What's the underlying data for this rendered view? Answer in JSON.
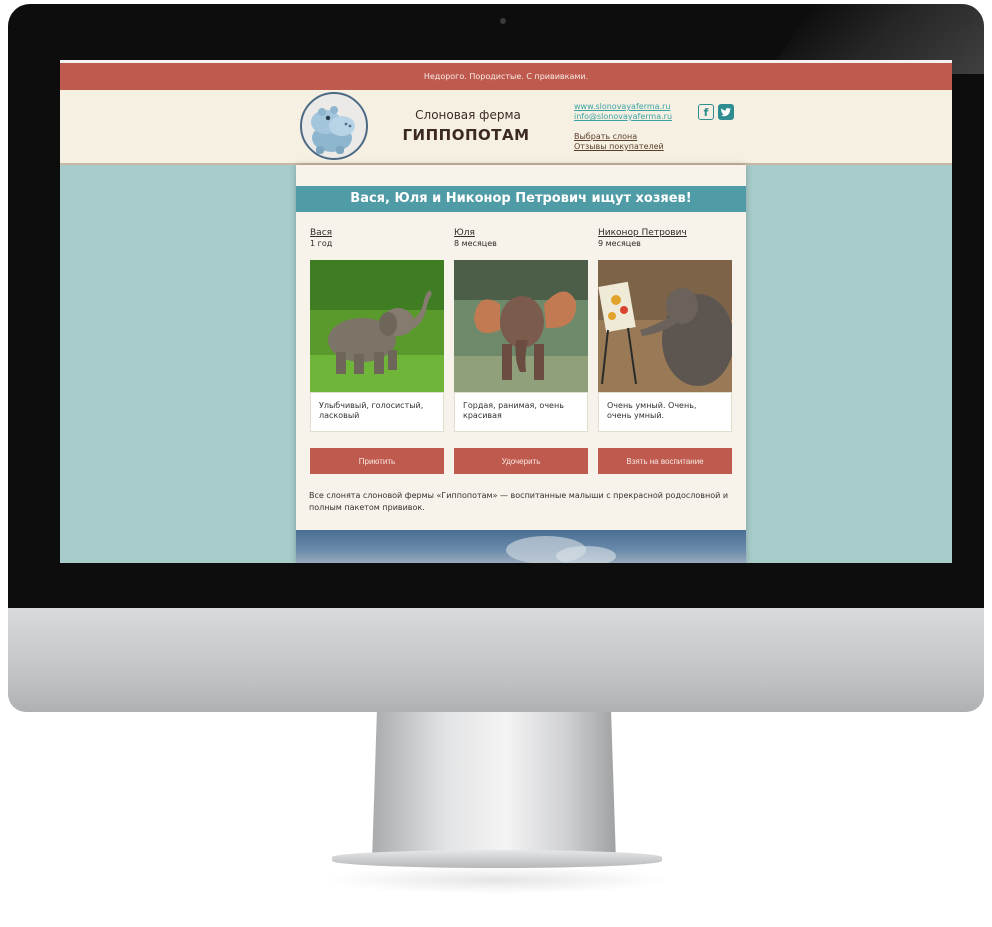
{
  "email": {
    "topbar_text": "Недорого. Породистые. С прививками.",
    "brand_small": "Слоновая ферма",
    "brand_big": "ГИППОПОТАМ",
    "links": {
      "site": "www.slonovayaferma.ru",
      "email": "info@slonovayaferma.ru",
      "choose": "Выбрать слона",
      "reviews": "Отзывы покупателей"
    },
    "social": [
      {
        "name": "facebook",
        "glyph": "f"
      },
      {
        "name": "twitter",
        "glyph": "t"
      }
    ],
    "banner": "Вася, Юля и Никонор Петрович ищут хозяев!",
    "elephants": [
      {
        "name": "Вася",
        "age": "1 год",
        "desc": "Улыбчивый, голосистый, ласковый",
        "button": "Приютить"
      },
      {
        "name": "Юля",
        "age": "8 месяцев",
        "desc": "Гордая, ранимая, очень красивая",
        "button": "Удочерить"
      },
      {
        "name": "Никонор Петрович",
        "age": "9 месяцев",
        "desc": "Очень умный. Очень, очень умный.",
        "button": "Взять на воспитание"
      }
    ],
    "footnote": "Все слонята слоновой фермы «Гиппопотам» — воспитанные малыши с прекрасной родословной и полным пакетом прививок."
  },
  "colors": {
    "accent_red": "#bf5b4e",
    "teal_banner": "#4f9ba6",
    "page_bg": "#a8ccca",
    "header_bg": "#f6f0e2"
  }
}
